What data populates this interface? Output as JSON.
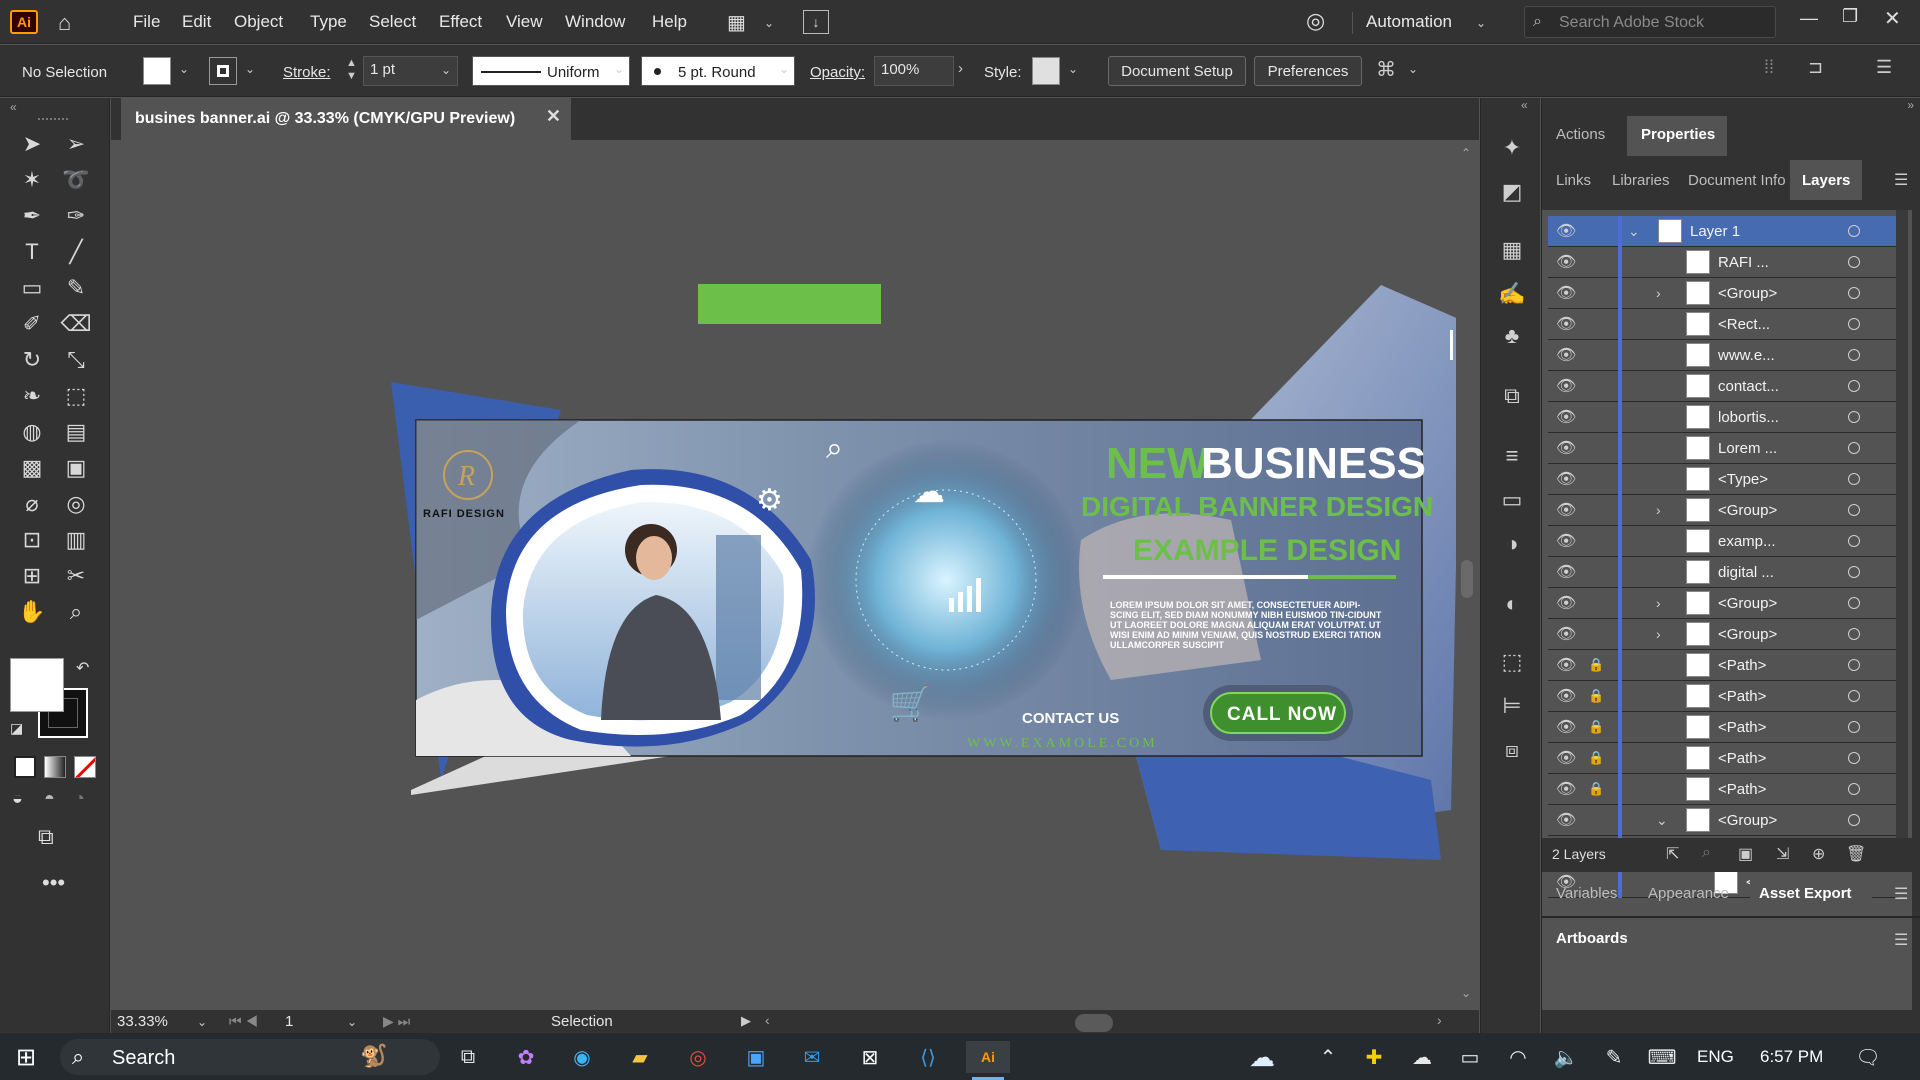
{
  "app": {
    "logo": "Ai"
  },
  "menu": {
    "items": [
      "File",
      "Edit",
      "Object",
      "Type",
      "Select",
      "Effect",
      "View",
      "Window",
      "Help"
    ],
    "workspace": "Automation",
    "search_placeholder": "Search Adobe Stock"
  },
  "control": {
    "selection": "No Selection",
    "stroke_label": "Stroke:",
    "stroke_weight": "1 pt",
    "stroke_profile": "Uniform",
    "brush": "5 pt. Round",
    "opacity_label": "Opacity:",
    "opacity": "100%",
    "style_label": "Style:",
    "document_setup": "Document Setup",
    "preferences": "Preferences"
  },
  "document": {
    "tab_title": "busines banner.ai @ 33.33% (CMYK/GPU Preview)",
    "close_glyph": "✕"
  },
  "banner": {
    "logo_text": "RAFI DESIGN",
    "headline_new": "NEW",
    "headline_business": "BUSINESS",
    "subhead1": "DIGITAL BANNER DESIGN",
    "subhead2": "EXAMPLE DESIGN",
    "body": "LOREM IPSUM DOLOR SIT AMET, CONSECTETUER ADIPI-SCING ELIT, SED DIAM NONUMMY NIBH EUISMOD TIN-CIDUNT UT LAOREET DOLORE MAGNA ALIQUAM ERAT VOLUTPAT. UT WISI ENIM AD MINIM VENIAM, QUIS NOSTRUD EXERCI TATION ULLAMCORPER SUSCIPIT",
    "contact": "CONTACT US",
    "cta": "CALL NOW",
    "url": "WWW.EXAMOLE.COM"
  },
  "status": {
    "zoom": "33.33%",
    "artboard": "1",
    "tool": "Selection"
  },
  "panel": {
    "top_tabs": [
      "Actions",
      "Properties"
    ],
    "tabs": [
      "Links",
      "Libraries",
      "Document Info",
      "Layers"
    ],
    "layers": [
      {
        "name": "Layer 1",
        "level": 0,
        "twirl": "open",
        "lock": false
      },
      {
        "name": "RAFI ...",
        "level": 1,
        "twirl": "",
        "lock": false
      },
      {
        "name": "<Group>",
        "level": 1,
        "twirl": "closed",
        "lock": false
      },
      {
        "name": "<Rect...",
        "level": 1,
        "twirl": "",
        "lock": false
      },
      {
        "name": "www.e...",
        "level": 1,
        "twirl": "",
        "lock": false
      },
      {
        "name": "contact...",
        "level": 1,
        "twirl": "",
        "lock": false
      },
      {
        "name": "lobortis...",
        "level": 1,
        "twirl": "",
        "lock": false
      },
      {
        "name": "Lorem ...",
        "level": 1,
        "twirl": "",
        "lock": false
      },
      {
        "name": "<Type>",
        "level": 1,
        "twirl": "",
        "lock": false
      },
      {
        "name": "<Group>",
        "level": 1,
        "twirl": "closed",
        "lock": false
      },
      {
        "name": "examp...",
        "level": 1,
        "twirl": "",
        "lock": false
      },
      {
        "name": "digital ...",
        "level": 1,
        "twirl": "",
        "lock": false
      },
      {
        "name": "<Group>",
        "level": 1,
        "twirl": "closed",
        "lock": false
      },
      {
        "name": "<Group>",
        "level": 1,
        "twirl": "closed",
        "lock": false
      },
      {
        "name": "<Path>",
        "level": 1,
        "twirl": "",
        "lock": true
      },
      {
        "name": "<Path>",
        "level": 1,
        "twirl": "",
        "lock": true
      },
      {
        "name": "<Path>",
        "level": 1,
        "twirl": "",
        "lock": true
      },
      {
        "name": "<Path>",
        "level": 1,
        "twirl": "",
        "lock": true
      },
      {
        "name": "<Path>",
        "level": 1,
        "twirl": "",
        "lock": true
      },
      {
        "name": "<Group>",
        "level": 1,
        "twirl": "open",
        "lock": false
      },
      {
        "name": "...",
        "level": 2,
        "twirl": "closed",
        "lock": false
      },
      {
        "name": "<...",
        "level": 2,
        "twirl": "",
        "lock": false
      }
    ],
    "layer_count": "2 Layers",
    "bottom_tabs": [
      "Variables",
      "Appearance",
      "Asset Export"
    ],
    "artboards": "Artboards"
  },
  "taskbar": {
    "search": "Search",
    "lang": "ENG",
    "time": "6:57 PM"
  },
  "colors": {
    "green": "#6cc04a",
    "blue": "#2f4fa8",
    "accent": "#4f6bd7"
  }
}
